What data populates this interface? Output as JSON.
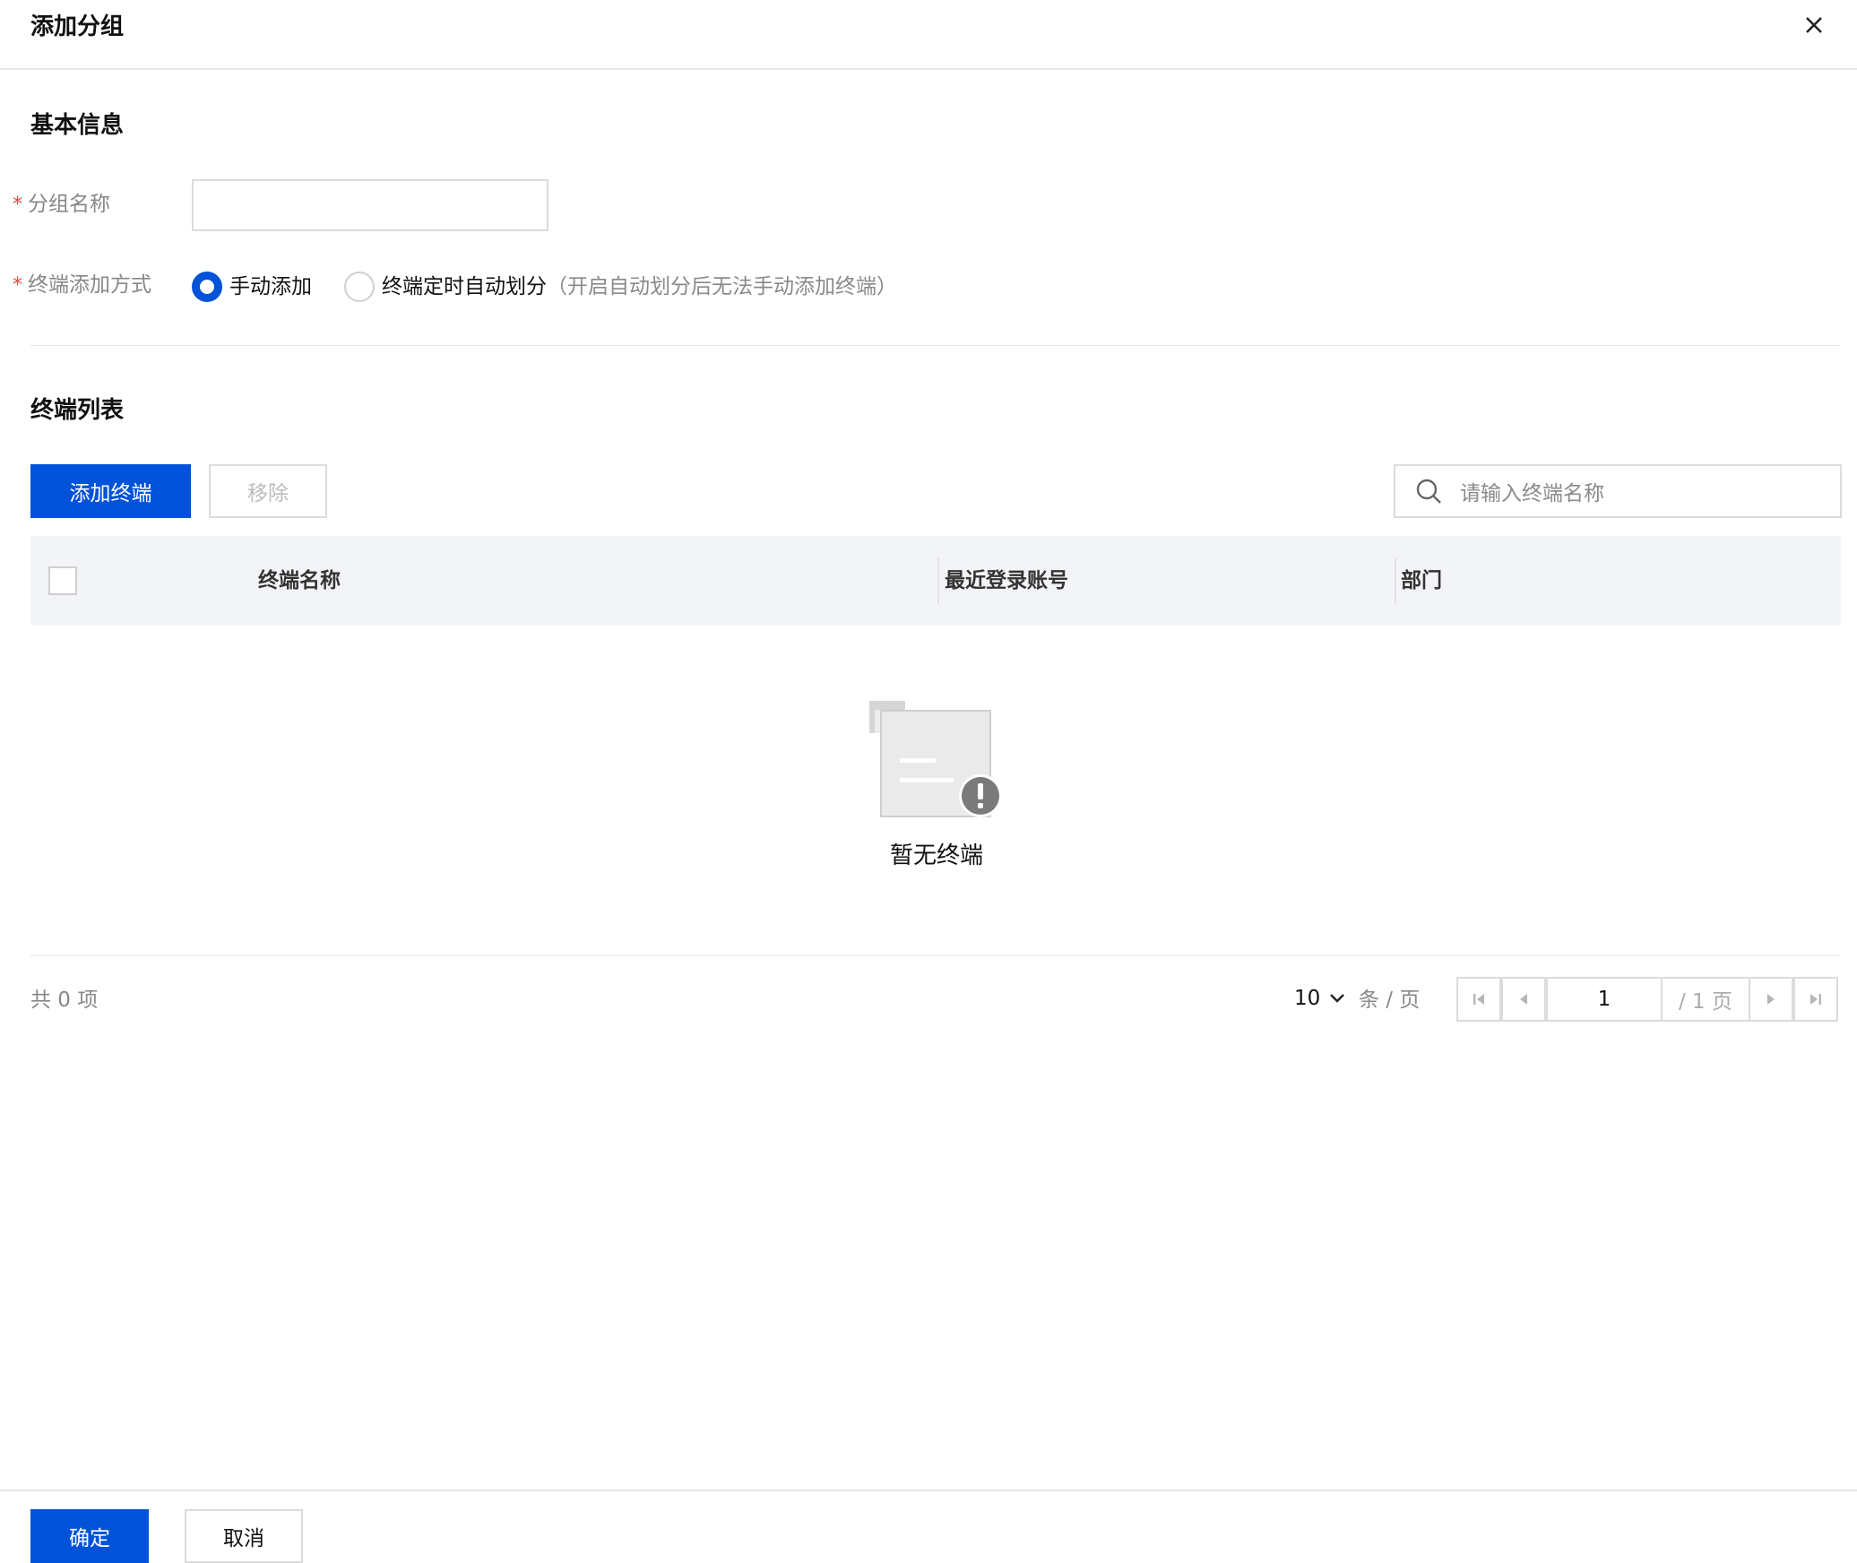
{
  "dialog": {
    "title": "添加分组",
    "close_icon": "close-icon"
  },
  "basic_info": {
    "section_title": "基本信息",
    "group_name_label": "分组名称",
    "group_name_value": "",
    "add_method_label": "终端添加方式",
    "required_mark": "*",
    "options": [
      {
        "label": "手动添加",
        "hint": "",
        "selected": true
      },
      {
        "label": "终端定时自动划分",
        "hint": "（开启自动划分后无法手动添加终端）",
        "selected": false
      }
    ]
  },
  "terminal_list": {
    "section_title": "终端列表",
    "add_button": "添加终端",
    "remove_button": "移除",
    "search_placeholder": "请输入终端名称",
    "columns": [
      "终端名称",
      "最近登录账号",
      "部门"
    ],
    "rows": [],
    "empty_text": "暂无终端",
    "empty_icon": "empty-list-illustration"
  },
  "pagination": {
    "total_text": "共 0 项",
    "page_size": "10",
    "page_size_unit": "条 / 页",
    "current_page": "1",
    "total_pages": "/ 1 页"
  },
  "footer": {
    "confirm_button": "确定",
    "cancel_button": "取消"
  },
  "colors": {
    "primary": "#0052d9",
    "required": "#e54545",
    "table_header_bg": "#f3f4f7"
  }
}
